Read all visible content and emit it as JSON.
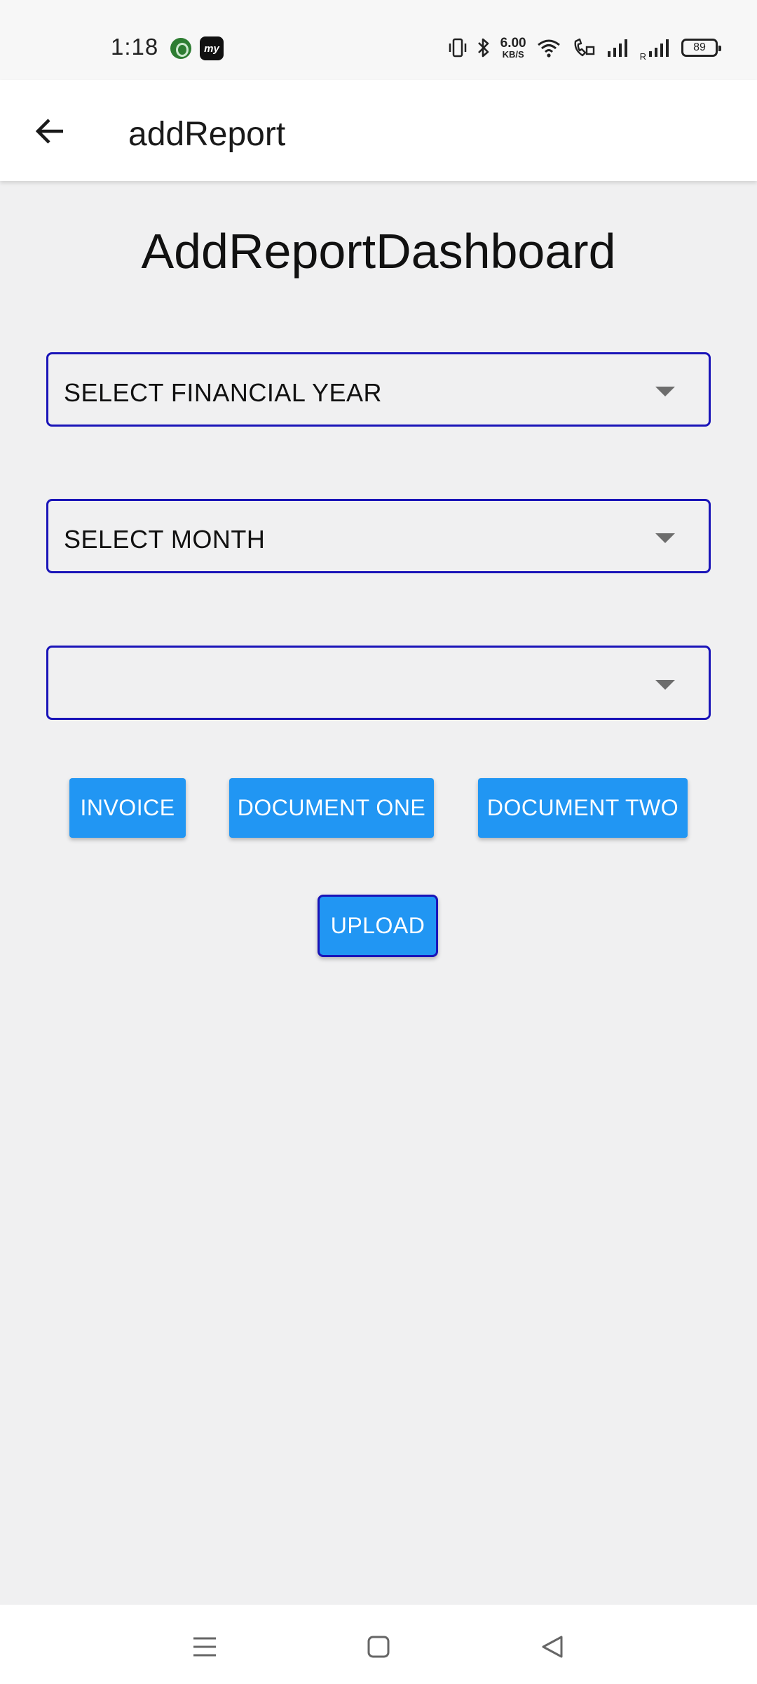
{
  "status_bar": {
    "time": "1:18",
    "notif_app_label": "my",
    "net_speed_value": "6.00",
    "net_speed_unit": "KB/S",
    "roaming_label": "R",
    "battery_level": "89"
  },
  "app_bar": {
    "title": "addReport"
  },
  "main": {
    "heading": "AddReportDashboard",
    "financial_year_select": {
      "value": "SELECT FINANCIAL YEAR"
    },
    "month_select": {
      "value": "SELECT MONTH"
    },
    "third_select": {
      "value": ""
    },
    "buttons": {
      "invoice": "INVOICE",
      "document_one": "DOCUMENT ONE",
      "document_two": "DOCUMENT TWO",
      "upload": "UPLOAD"
    }
  },
  "colors": {
    "accent_button": "#2196f3",
    "select_border": "#1a14b8",
    "background": "#f0f0f1"
  },
  "icons": {
    "back": "arrow-left-icon",
    "nav_menu": "menu-icon",
    "nav_home": "square-home-icon",
    "nav_back": "triangle-back-icon"
  }
}
